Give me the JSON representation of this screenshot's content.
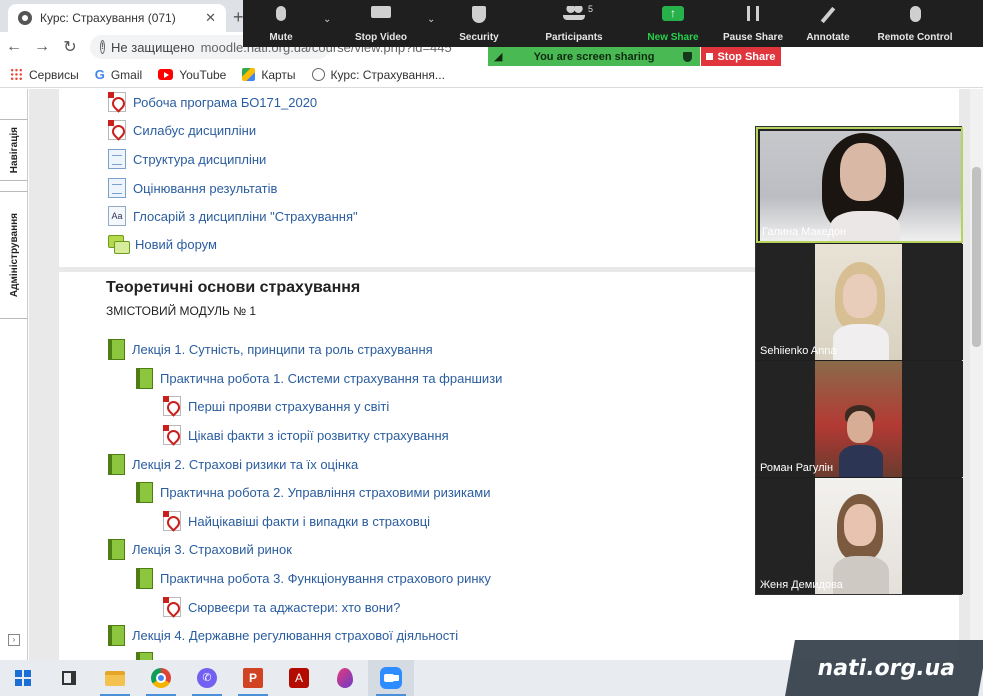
{
  "browser": {
    "tab_title": "Курс: Страхування (071)",
    "tab_close": "✕",
    "new_tab": "+",
    "nav": {
      "back": "←",
      "forward": "→",
      "reload": "↻"
    },
    "security_label": "Не защищено",
    "url": "moodle.nati.org.ua/course/view.php?id=445",
    "bookmarks": [
      {
        "label": "Сервисы",
        "icon": "apps-icon"
      },
      {
        "label": "Gmail",
        "icon": "google-icon"
      },
      {
        "label": "YouTube",
        "icon": "youtube-icon"
      },
      {
        "label": "Карты",
        "icon": "maps-icon"
      },
      {
        "label": "Курс: Страхування...",
        "icon": "globe-icon"
      }
    ]
  },
  "zoom": {
    "controls": [
      {
        "label": "Mute",
        "icon": "microphone-icon",
        "has_caret": true
      },
      {
        "label": "Stop Video",
        "icon": "video-camera-icon",
        "has_caret": true
      },
      {
        "label": "Security",
        "icon": "shield-icon"
      },
      {
        "label": "Participants",
        "icon": "participants-icon",
        "badge": "5"
      },
      {
        "label": "New Share",
        "icon": "share-arrow-icon",
        "accent": "#26d04c"
      },
      {
        "label": "Pause Share",
        "icon": "pause-icon"
      },
      {
        "label": "Annotate",
        "icon": "pen-icon"
      },
      {
        "label": "Remote Control",
        "icon": "mouse-icon"
      }
    ],
    "sharing_banner": "You are screen sharing",
    "stop_share": "Stop Share",
    "participants": [
      {
        "name": "Галина Македон",
        "active_speaker": true
      },
      {
        "name": "Sehiienko Anna"
      },
      {
        "name": "Роман Рагулін"
      },
      {
        "name": "Женя  Демидова"
      }
    ]
  },
  "moodle": {
    "side_tabs": [
      "Навігація",
      "Адміністрування"
    ],
    "top_activities": [
      {
        "label": "Робоча програма БО171_2020",
        "icon": "pdf-icon"
      },
      {
        "label": "Силабус дисципліни",
        "icon": "pdf-icon"
      },
      {
        "label": "Структура дисципліни",
        "icon": "page-icon"
      },
      {
        "label": "Оцінювання результатів",
        "icon": "page-icon"
      },
      {
        "label": "Глосарій з дисципліни \"Страхування\"",
        "icon": "glossary-icon"
      },
      {
        "label": "Новий форум",
        "icon": "forum-icon"
      }
    ],
    "section_title": "Теоретичні основи страхування",
    "module_label": "ЗМІСТОВИЙ МОДУЛЬ № 1",
    "section_items": [
      {
        "label": "Лекція 1. Сутність, принципи та роль страхування",
        "icon": "book-icon",
        "indent": 0
      },
      {
        "label": "Практична робота 1. Системи страхування та франшизи",
        "icon": "book-icon",
        "indent": 1
      },
      {
        "label": "Перші прояви страхування у світі",
        "icon": "pdf-icon",
        "indent": 2
      },
      {
        "label": "Цікаві факти з історії розвитку страхування",
        "icon": "pdf-icon",
        "indent": 2
      },
      {
        "label": "Лекція 2. Страхові ризики та їх оцінка",
        "icon": "book-icon",
        "indent": 0
      },
      {
        "label": "Практична робота 2. Управління страховими ризиками",
        "icon": "book-icon",
        "indent": 1
      },
      {
        "label": "Найцікавіші факти і випадки в страховці",
        "icon": "pdf-icon",
        "indent": 2
      },
      {
        "label": "Лекція 3. Страховий ринок",
        "icon": "book-icon",
        "indent": 0
      },
      {
        "label": "Практична робота 3. Функціонування страхового ринку",
        "icon": "book-icon",
        "indent": 1
      },
      {
        "label": "Сюрвеєри та аджастери: хто вони?",
        "icon": "pdf-icon",
        "indent": 2
      },
      {
        "label": "Лекція 4. Державне регулювання страхової діяльності",
        "icon": "book-icon",
        "indent": 0
      }
    ]
  },
  "taskbar": {
    "apps": [
      "start-icon",
      "task-view-icon",
      "file-explorer-icon",
      "chrome-icon",
      "viber-icon",
      "powerpoint-icon",
      "acrobat-icon",
      "drop-app-icon",
      "zoom-app-icon"
    ]
  },
  "watermark": "nati.org.ua"
}
